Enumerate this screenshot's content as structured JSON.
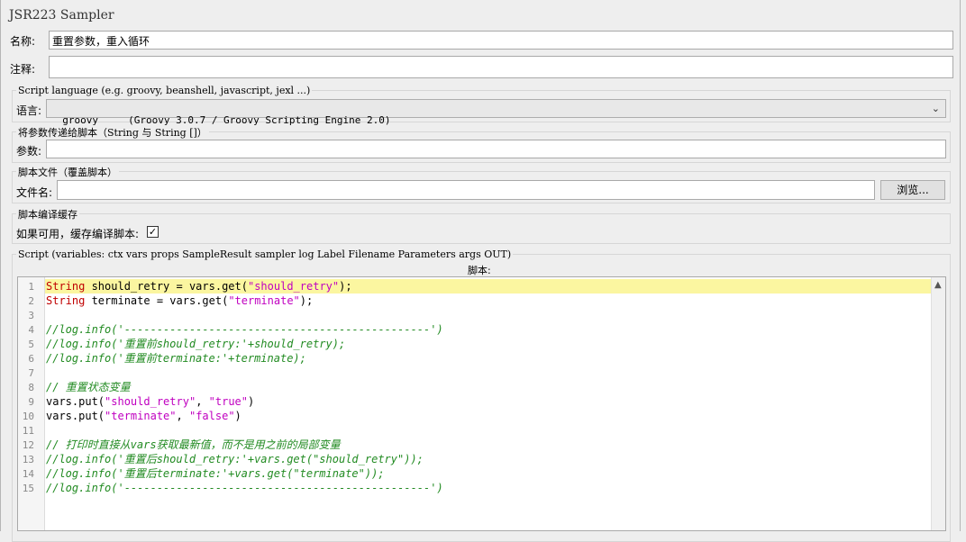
{
  "sampler": {
    "title": "JSR223 Sampler",
    "name_label": "名称:",
    "name_value": "重置参数，重入循环",
    "comments_label": "注释:",
    "comments_value": ""
  },
  "script_language": {
    "group_title": "Script language (e.g. groovy, beanshell, javascript, jexl ...)",
    "label": "语言:",
    "selected": "groovy     (Groovy 3.0.7 / Groovy Scripting Engine 2.0)"
  },
  "parameters": {
    "group_title": "将参数传递给脚本（String 与 String []）",
    "label": "参数:",
    "value": ""
  },
  "script_file": {
    "group_title": "脚本文件（覆盖脚本）",
    "label": "文件名:",
    "value": "",
    "browse_label": "浏览..."
  },
  "compile_cache": {
    "group_title": "脚本编译缓存",
    "label": "如果可用，缓存编译脚本:",
    "checked": true
  },
  "script": {
    "group_title": "Script (variables: ctx vars props SampleResult sampler log Label Filename Parameters args OUT)",
    "label": "脚本:",
    "line_numbers": [
      "1",
      "2",
      "3",
      "4",
      "5",
      "6",
      "7",
      "8",
      "9",
      "10",
      "11",
      "12",
      "13",
      "14",
      "15"
    ],
    "lines": [
      [
        {
          "t": "String",
          "c": "kw"
        },
        {
          "t": " should_retry = vars.get("
        },
        {
          "t": "\"should_retry\"",
          "c": "str"
        },
        {
          "t": ");"
        }
      ],
      [
        {
          "t": "String",
          "c": "kw"
        },
        {
          "t": " terminate = vars.get("
        },
        {
          "t": "\"terminate\"",
          "c": "str"
        },
        {
          "t": ");"
        }
      ],
      [],
      [
        {
          "t": "//log.info('-----------------------------------------------')",
          "c": "cm"
        }
      ],
      [
        {
          "t": "//log.info('重置前should_retry:'+should_retry);",
          "c": "cm"
        }
      ],
      [
        {
          "t": "//log.info('重置前terminate:'+terminate);",
          "c": "cm"
        }
      ],
      [],
      [
        {
          "t": "// 重置状态变量",
          "c": "cm"
        }
      ],
      [
        {
          "t": "vars.put("
        },
        {
          "t": "\"should_retry\"",
          "c": "str"
        },
        {
          "t": ", "
        },
        {
          "t": "\"true\"",
          "c": "str"
        },
        {
          "t": ")"
        }
      ],
      [
        {
          "t": "vars.put("
        },
        {
          "t": "\"terminate\"",
          "c": "str"
        },
        {
          "t": ", "
        },
        {
          "t": "\"false\"",
          "c": "str"
        },
        {
          "t": ")"
        }
      ],
      [],
      [
        {
          "t": "// 打印时直接从vars获取最新值，而不是用之前的局部变量",
          "c": "cm"
        }
      ],
      [
        {
          "t": "//log.info('重置后should_retry:'+vars.get(\"should_retry\"));",
          "c": "cm"
        }
      ],
      [
        {
          "t": "//log.info('重置后terminate:'+vars.get(\"terminate\"));",
          "c": "cm"
        }
      ],
      [
        {
          "t": "//log.info('-----------------------------------------------')",
          "c": "cm"
        }
      ]
    ]
  },
  "colors": {
    "keyword": "#c00000",
    "string": "#c000c0",
    "comment": "#228b22",
    "current_line": "#fbf6a0"
  }
}
